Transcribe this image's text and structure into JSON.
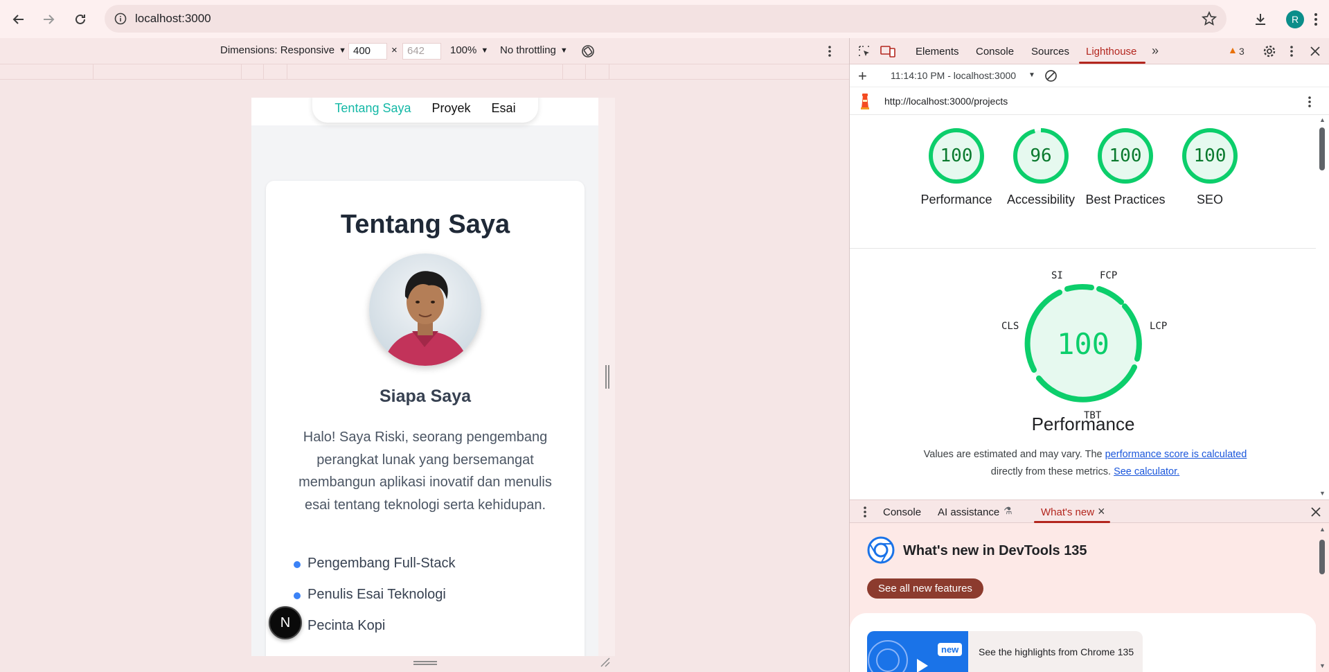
{
  "browser": {
    "url": "localhost:3000",
    "avatar_letter": "R"
  },
  "device_toolbar": {
    "dimensions_label": "Dimensions: Responsive",
    "width": "400",
    "height_placeholder": "642",
    "zoom": "100%",
    "throttling": "No throttling"
  },
  "site": {
    "nav": [
      "Tentang Saya",
      "Proyek",
      "Esai"
    ],
    "title": "Tentang Saya",
    "subtitle": "Siapa Saya",
    "intro": "Halo! Saya Riski, seorang pengembang perangkat lunak yang bersemangat membangun aplikasi inovatif dan menulis esai tentang teknologi serta kehidupan.",
    "traits": [
      "Pengembang Full-Stack",
      "Penulis Esai Teknologi",
      "Pecinta Kopi"
    ],
    "next_badge": "N"
  },
  "devtools": {
    "tabs": [
      "Elements",
      "Console",
      "Sources",
      "Lighthouse"
    ],
    "active_tab": "Lighthouse",
    "warning_count": "3",
    "report_time": "11:14:10 PM - localhost:3000",
    "report_url": "http://localhost:3000/projects",
    "scores": [
      {
        "score": 100,
        "label": "Performance"
      },
      {
        "score": 96,
        "label": "Accessibility"
      },
      {
        "score": 100,
        "label": "Best Practices"
      },
      {
        "score": 100,
        "label": "SEO"
      }
    ],
    "performance": {
      "score": 100,
      "title": "Performance",
      "metrics": [
        "SI",
        "FCP",
        "LCP",
        "TBT",
        "CLS"
      ],
      "note_prefix": "Values are estimated and may vary. The ",
      "note_link1": "performance score is calculated",
      "note_mid": " directly from these metrics. ",
      "note_link2": "See calculator."
    },
    "drawer_tabs": [
      "Console",
      "AI assistance",
      "What's new"
    ],
    "whats_new": {
      "title": "What's new in DevTools 135",
      "button": "See all new features",
      "badge": "new",
      "highlight": "See the highlights from Chrome 135"
    },
    "colors": {
      "pass": "#0cce6b",
      "accent": "#b3261e"
    }
  }
}
